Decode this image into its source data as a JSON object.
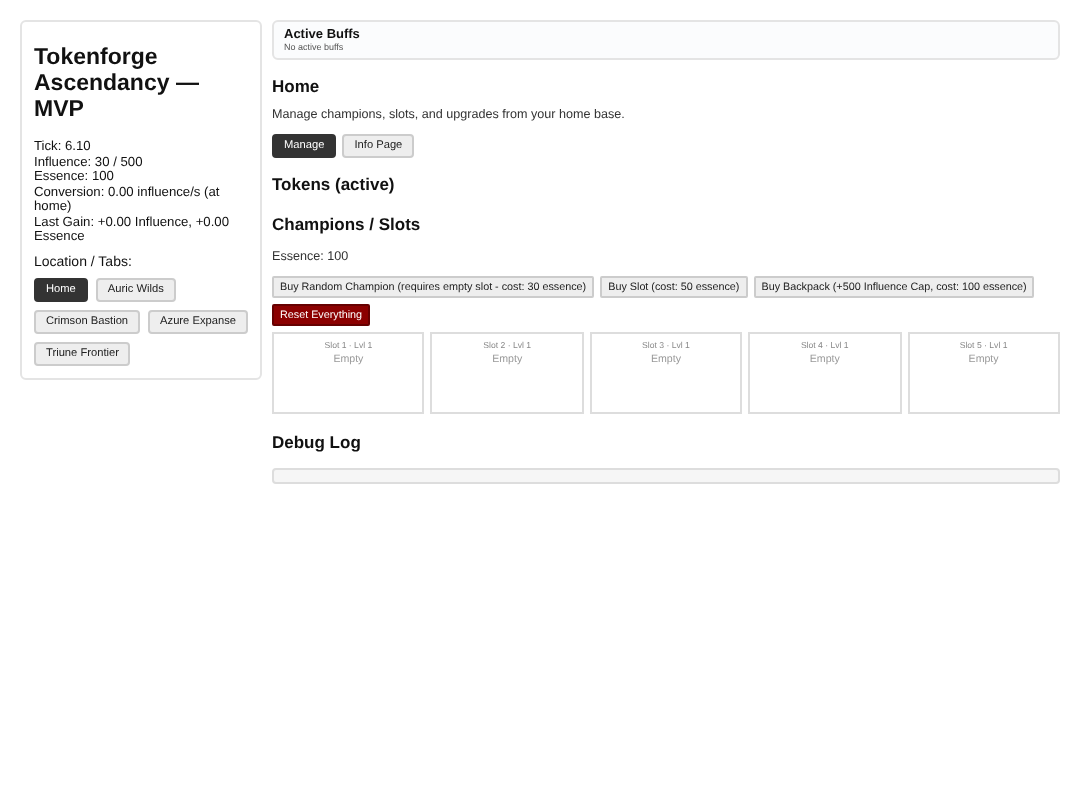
{
  "sidebar": {
    "title": "Tokenforge Ascendancy — MVP",
    "stats": [
      "Tick: 6.10",
      "Influence: 30 / 500",
      "Essence: 100",
      "Conversion: 0.00 influence/s (at home)",
      "Last Gain: +0.00 Influence, +0.00 Essence"
    ],
    "tabs_label": "Location / Tabs:",
    "tabs": [
      {
        "label": "Home",
        "selected": true
      },
      {
        "label": "Auric Wilds",
        "selected": false
      },
      {
        "label": "Crimson Bastion",
        "selected": false
      },
      {
        "label": "Azure Expanse",
        "selected": false
      },
      {
        "label": "Triune Frontier",
        "selected": false
      }
    ]
  },
  "buffs": {
    "title": "Active Buffs",
    "text": "No active buffs"
  },
  "home": {
    "title": "Home",
    "description": "Manage champions, slots, and upgrades from your home base.",
    "views": [
      {
        "label": "Manage",
        "selected": true
      },
      {
        "label": "Info Page",
        "selected": false
      }
    ]
  },
  "tokens": {
    "title": "Tokens (active)"
  },
  "champions": {
    "title": "Champions / Slots",
    "essence": "Essence: 100",
    "actions": [
      {
        "label": "Buy Random Champion (requires empty slot - cost: 30 essence)",
        "kind": "normal"
      },
      {
        "label": "Buy Slot (cost: 50 essence)",
        "kind": "normal"
      },
      {
        "label": "Buy Backpack (+500 Influence Cap, cost: 100 essence)",
        "kind": "normal"
      },
      {
        "label": "Reset Everything",
        "kind": "danger"
      }
    ],
    "slots": [
      {
        "header": "Slot 1 · Lvl 1",
        "content": "Empty"
      },
      {
        "header": "Slot 2 · Lvl 1",
        "content": "Empty"
      },
      {
        "header": "Slot 3 · Lvl 1",
        "content": "Empty"
      },
      {
        "header": "Slot 4 · Lvl 1",
        "content": "Empty"
      },
      {
        "header": "Slot 5 · Lvl 1",
        "content": "Empty"
      }
    ]
  },
  "debug": {
    "title": "Debug Log"
  }
}
